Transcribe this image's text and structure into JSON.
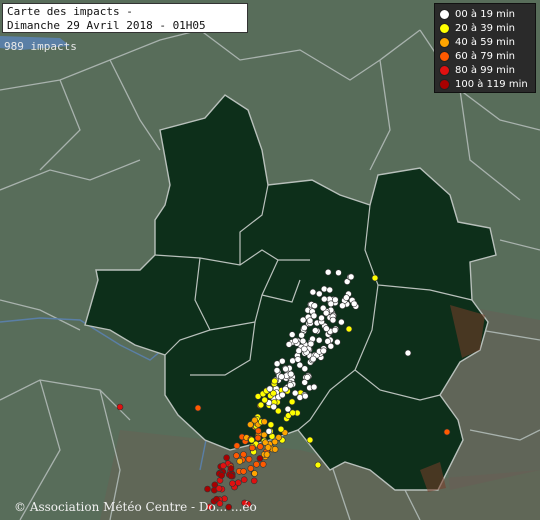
{
  "map": {
    "title_line1": "Carte des impacts -",
    "title_line2": "Dimanche 29 Avril 2018 - 01H05",
    "impact_count": "989 impacts",
    "copyright": "© Association Météo Centre - Dо... ...éо"
  },
  "legend": {
    "items": [
      {
        "label": "00 à 19 min",
        "color": "#ffffff"
      },
      {
        "label": "20 à 39 min",
        "color": "#ffff00"
      },
      {
        "label": "40 à 59 min",
        "color": "#ffa500"
      },
      {
        "label": "60 à 79 min",
        "color": "#ff5a00"
      },
      {
        "label": "80 à 99 min",
        "color": "#e01010"
      },
      {
        "label": "100 à 119 min",
        "color": "#a80000"
      }
    ]
  },
  "colors": {
    "background": "#586d5a",
    "region": "#0d2f1a",
    "borders": "#9aa6a0",
    "rivers": "#5a7fa6"
  }
}
